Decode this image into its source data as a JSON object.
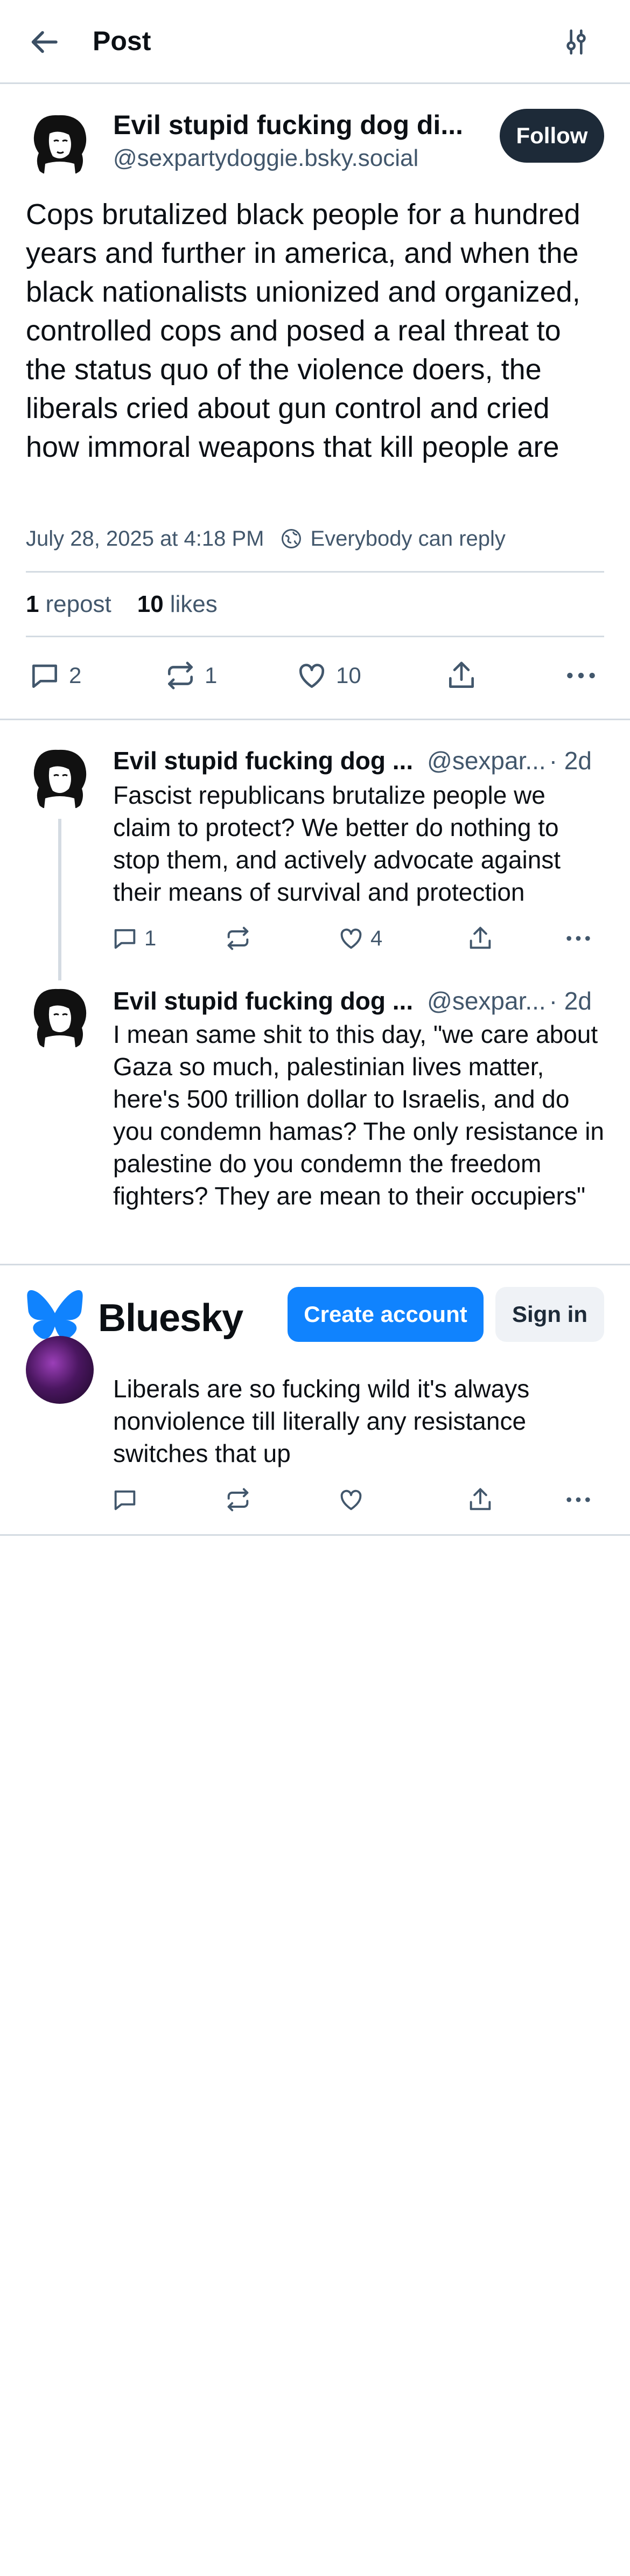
{
  "header": {
    "title": "Post"
  },
  "post": {
    "author_name": "Evil stupid fucking dog di...",
    "author_handle": "@sexpartydoggie.bsky.social",
    "follow_label": "Follow",
    "text": "Cops brutalized black people for a hundred years and further in america, and when the black nationalists unionized and organized, controlled cops and posed a real threat to the status quo of the violence doers, the liberals cried about gun control and cried how immoral weapons that kill people are",
    "timestamp": "July 28, 2025 at 4:18 PM",
    "reply_setting": "Everybody can reply",
    "reposts_count": "1",
    "reposts_label": "repost",
    "likes_count": "10",
    "likes_label": "likes",
    "reply_count": "2",
    "repost_count": "1",
    "like_count": "10"
  },
  "replies": [
    {
      "author_name": "Evil stupid fucking dog ...",
      "author_handle": "@sexpar...",
      "time": "· 2d",
      "text": "Fascist republicans brutalize people we claim to protect? We better do nothing to stop them, and actively advocate against their means of survival and protection",
      "reply_count": "1",
      "repost_count": "",
      "like_count": "4"
    },
    {
      "author_name": "Evil stupid fucking dog ...",
      "author_handle": "@sexpar...",
      "time": "· 2d",
      "text": "I mean same shit to this day, \"we care about Gaza so much, palestinian lives matter, here's 500 trillion dollar to Israelis, and do you condemn hamas? The only resistance in palestine do you condemn the freedom fighters? They are mean to their occupiers\""
    },
    {
      "text": "Liberals are so fucking wild it's always nonviolence till literally any resistance switches that up"
    }
  ],
  "banner": {
    "brand": "Bluesky",
    "create_label": "Create account",
    "signin_label": "Sign in",
    "brand_color": "#1083fe"
  },
  "icons": [
    "back-arrow-icon",
    "sliders-icon",
    "globe-reply-icon",
    "comment-icon",
    "repost-icon",
    "heart-icon",
    "share-icon",
    "more-icon",
    "bluesky-butterfly-icon"
  ]
}
